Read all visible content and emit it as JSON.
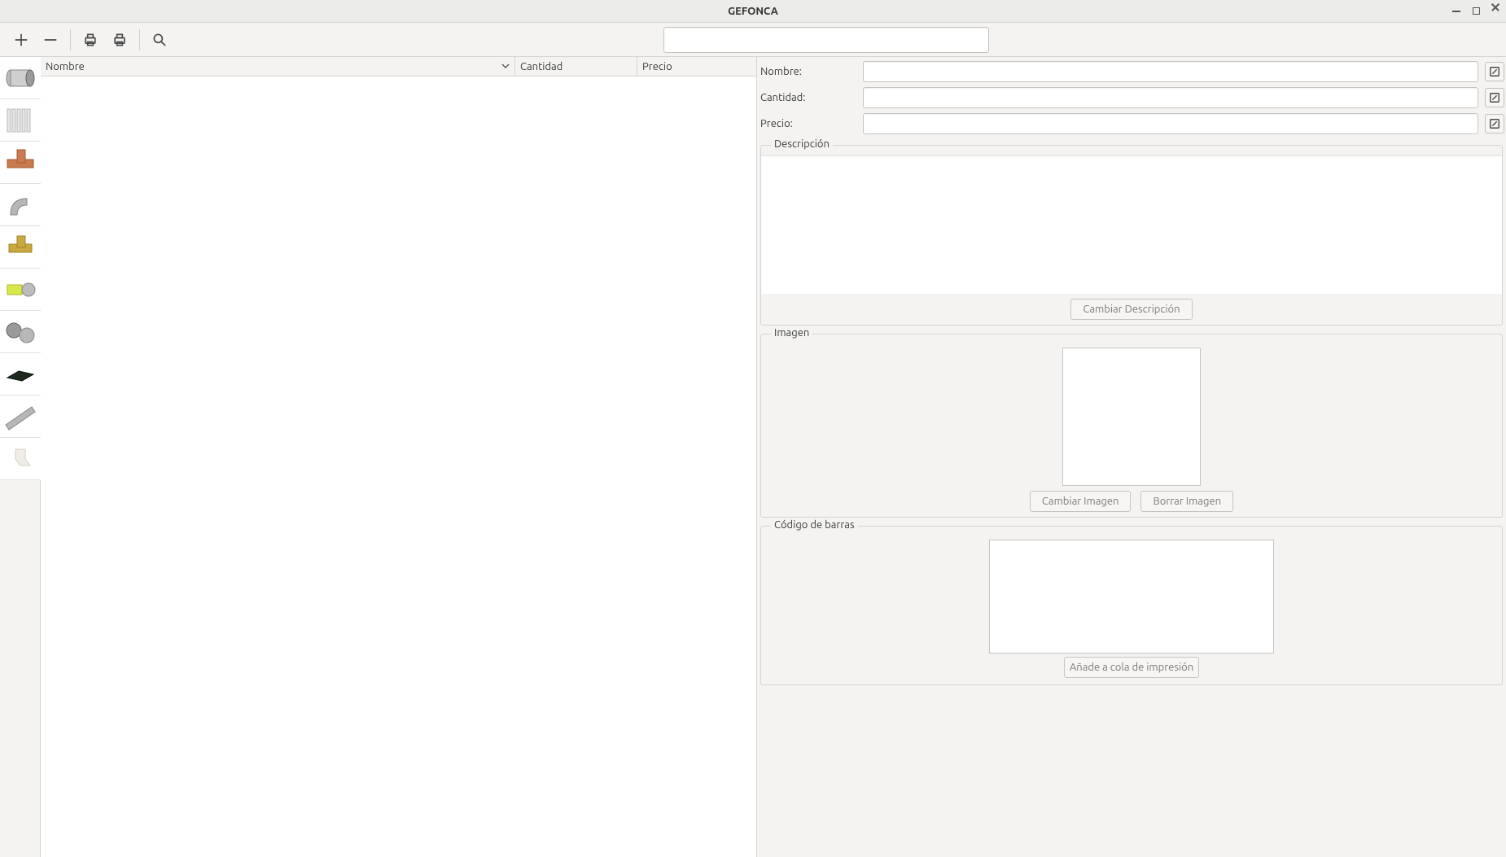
{
  "window": {
    "title": "GEFONCA"
  },
  "toolbar": {
    "search_value": ""
  },
  "table": {
    "headers": {
      "name": "Nombre",
      "qty": "Cantidad",
      "price": "Precio"
    }
  },
  "form": {
    "name_label": "Nombre:",
    "qty_label": "Cantidad:",
    "price_label": "Precio:",
    "name_value": "",
    "qty_value": "",
    "price_value": ""
  },
  "groups": {
    "description": "Descripción",
    "image": "Imagen",
    "barcode": "Código de barras"
  },
  "buttons": {
    "change_desc": "Cambiar Descripción",
    "change_image": "Cambiar Imagen",
    "delete_image": "Borrar Imagen",
    "add_to_print_queue": "Añade a cola de impresión"
  },
  "category_thumbs": [
    "pipe-fitting-1",
    "radiator",
    "copper-tee",
    "elbow-grey",
    "brass-fitting",
    "press-fitting",
    "pvc-joints",
    "black-fitting",
    "grey-pipe",
    "white-fitting"
  ]
}
